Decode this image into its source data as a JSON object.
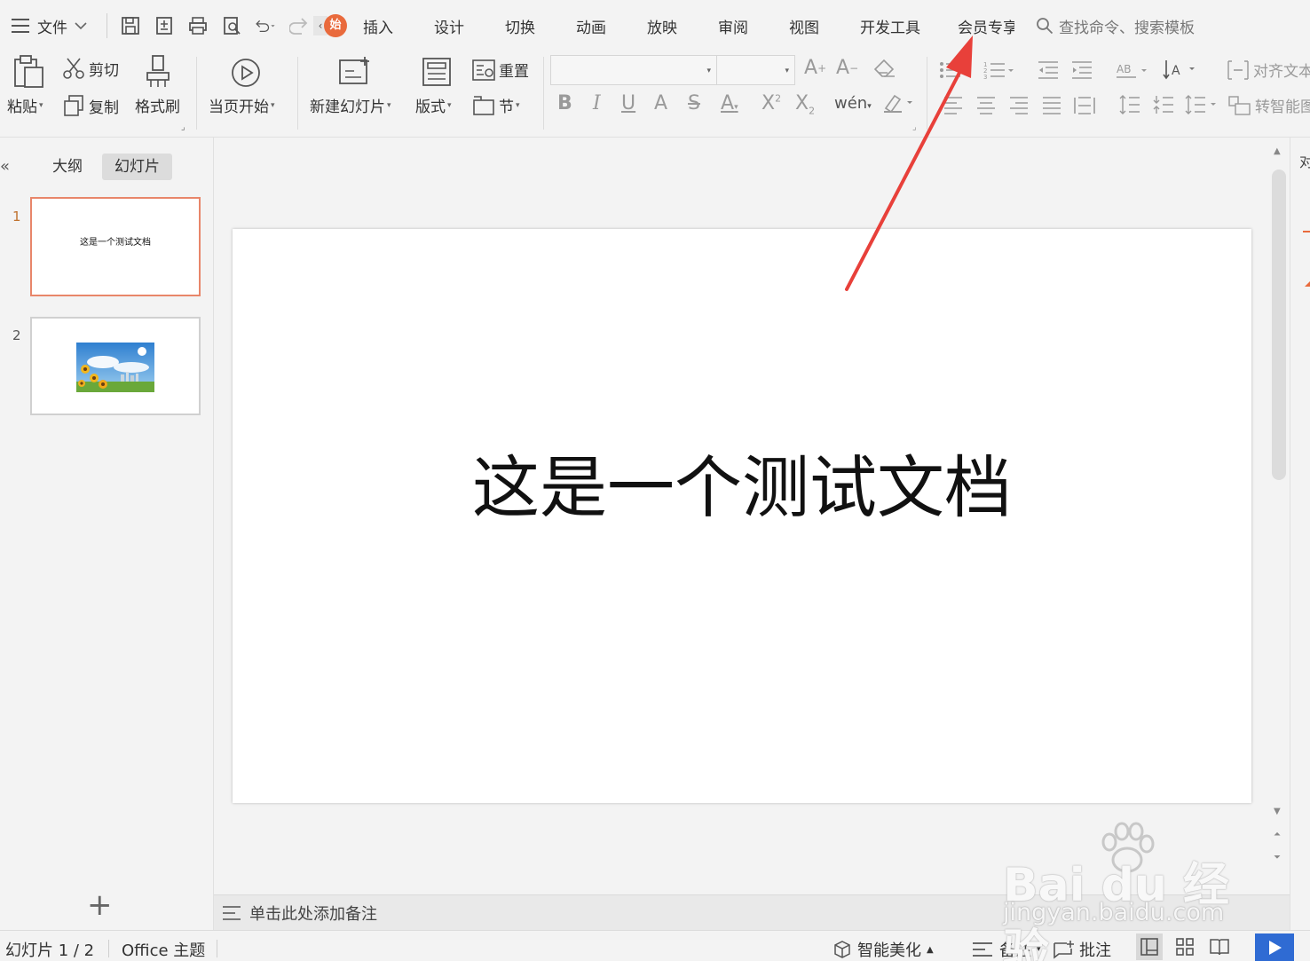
{
  "menubar": {
    "file_label": "文件",
    "start_tab_glyph": "始",
    "tabs": [
      "插入",
      "设计",
      "切换",
      "动画",
      "放映",
      "审阅",
      "视图",
      "开发工具",
      "会员专享"
    ],
    "search_placeholder": "查找命令、搜索模板"
  },
  "ribbon": {
    "paste": "粘贴",
    "cut": "剪切",
    "copy": "复制",
    "format_painter": "格式刷",
    "play_from_current": "当页开始",
    "new_slide": "新建幻灯片",
    "layout": "版式",
    "reset": "重置",
    "section": "节",
    "font_name": "",
    "font_size": "",
    "align_text": "对齐文本",
    "smart_convert": "转智能图形"
  },
  "left_panel": {
    "tab_outline": "大纲",
    "tab_slides": "幻灯片",
    "slides": [
      {
        "number": "1",
        "thumb_text": "这是一个测试文档"
      },
      {
        "number": "2",
        "thumb_text": ""
      }
    ]
  },
  "slide": {
    "title": "这是一个测试文档"
  },
  "notes_placeholder": "单击此处添加备注",
  "right_rail_label": "对",
  "status": {
    "slide_counter": "幻灯片 1 / 2",
    "theme": "Office 主题",
    "beautify": "智能美化",
    "notes": "备注",
    "comments": "批注"
  },
  "watermark": {
    "logo": "Bai du 经验",
    "url": "jingyan.baidu.com"
  },
  "colors": {
    "accent": "#e96a3c",
    "arrow": "#e8403a",
    "selection_border": "#e8866a",
    "play_button": "#2f6bd3"
  }
}
